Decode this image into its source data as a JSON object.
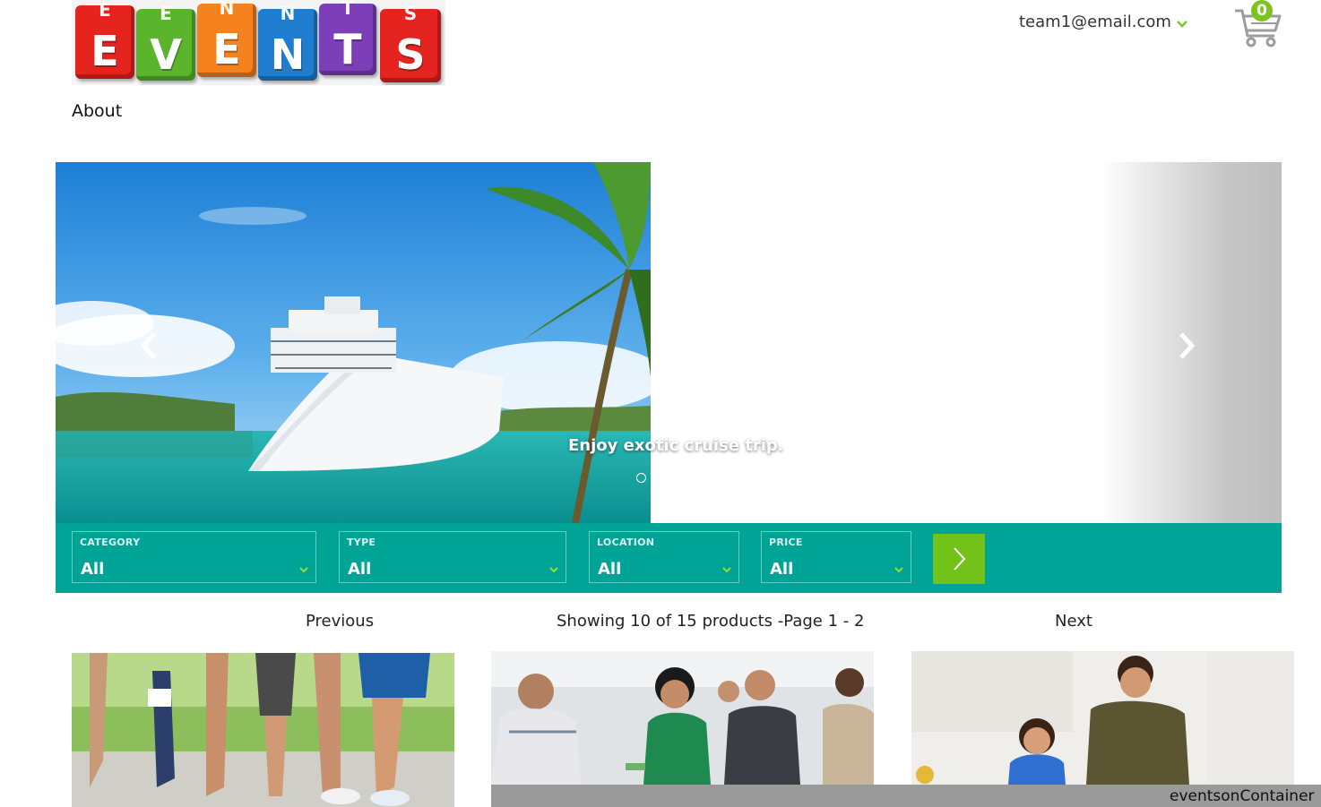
{
  "header": {
    "logo_letters": [
      "E",
      "V",
      "E",
      "N",
      "T",
      "S"
    ],
    "user_email": "team1@email.com",
    "cart_count": "0"
  },
  "nav": {
    "about": "About"
  },
  "carousel": {
    "caption": "Enjoy exotic cruise trip."
  },
  "filters": [
    {
      "label": "CATEGORY",
      "value": "All"
    },
    {
      "label": "TYPE",
      "value": "All"
    },
    {
      "label": "LOCATION",
      "value": "All"
    },
    {
      "label": "PRICE",
      "value": "All"
    }
  ],
  "pagination": {
    "previous": "Previous",
    "summary": "Showing 10 of 15 products -Page 1 - 2",
    "next": "Next"
  },
  "status_bar": {
    "text": "eventsonContainer"
  },
  "icons": [
    "shopping-cart-icon",
    "chevron-down-icon",
    "chevron-left-icon",
    "chevron-right-icon"
  ],
  "colors": {
    "teal": "#00a497",
    "green": "#72c21a",
    "cube_red": "#e5231f",
    "cube_green": "#5ab52c",
    "cube_orange": "#f3821f",
    "cube_blue": "#1e7dcf",
    "cube_purple": "#7d3fb8"
  }
}
